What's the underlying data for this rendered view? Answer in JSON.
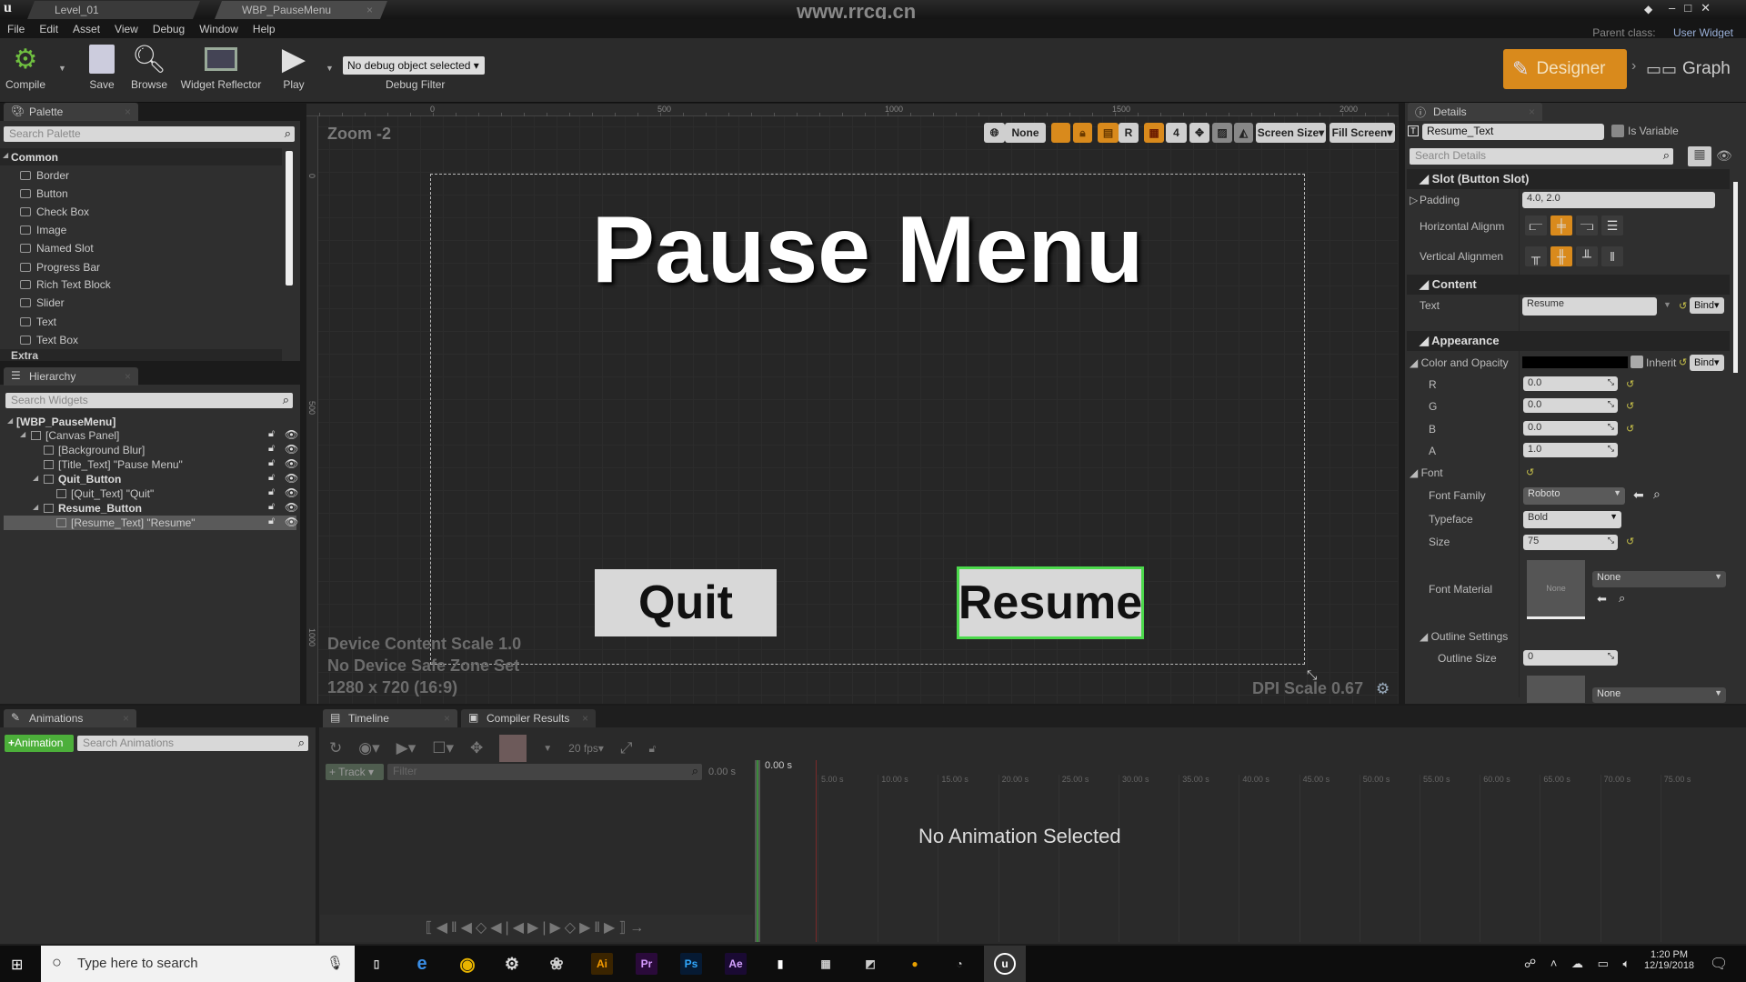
{
  "window": {
    "tabs": [
      "Level_01",
      "WBP_PauseMenu"
    ],
    "watermark": "www.rrcg.cn",
    "parent_class_label": "Parent class:",
    "parent_class": "User Widget"
  },
  "menu": [
    "File",
    "Edit",
    "Asset",
    "View",
    "Debug",
    "Window",
    "Help"
  ],
  "toolbar": {
    "compile": "Compile",
    "save": "Save",
    "browse": "Browse",
    "widget_reflector": "Widget Reflector",
    "play": "Play",
    "debug_object": "No debug object selected",
    "debug_filter": "Debug Filter",
    "designer": "Designer",
    "graph": "Graph"
  },
  "palette": {
    "title": "Palette",
    "search_placeholder": "Search Palette",
    "category": "Common",
    "items": [
      "Border",
      "Button",
      "Check Box",
      "Image",
      "Named Slot",
      "Progress Bar",
      "Rich Text Block",
      "Slider",
      "Text",
      "Text Box"
    ],
    "collapsed_category": "Extra"
  },
  "hierarchy": {
    "title": "Hierarchy",
    "search_placeholder": "Search Widgets",
    "items": [
      {
        "label": "[WBP_PauseMenu]",
        "depth": 0,
        "bold": true,
        "expander": true
      },
      {
        "label": "[Canvas Panel]",
        "depth": 1,
        "expander": true
      },
      {
        "label": "[Background Blur]",
        "depth": 2
      },
      {
        "label": "[Title_Text] \"Pause Menu\"",
        "depth": 2
      },
      {
        "label": "Quit_Button",
        "depth": 2,
        "bold": true,
        "expander": true
      },
      {
        "label": "[Quit_Text] \"Quit\"",
        "depth": 3
      },
      {
        "label": "Resume_Button",
        "depth": 2,
        "bold": true,
        "expander": true
      },
      {
        "label": "[Resume_Text] \"Resume\"",
        "depth": 3,
        "selected": true
      }
    ]
  },
  "canvas": {
    "zoom": "Zoom -2",
    "ruler_labels": [
      "0",
      "500",
      "1000",
      "1500",
      "2000"
    ],
    "left_ruler": [
      "0",
      "500",
      "1000"
    ],
    "toolbar": {
      "none": "None",
      "r": "R",
      "grid_size": "4",
      "screen_size": "Screen Size",
      "fill_screen": "Fill Screen"
    },
    "title_text": "Pause Menu",
    "quit_text": "Quit",
    "resume_text": "Resume",
    "info": [
      "Device Content Scale 1.0",
      "No Device Safe Zone Set",
      "1280 x 720 (16:9)"
    ],
    "dpi_scale": "DPI Scale 0.67"
  },
  "details": {
    "title": "Details",
    "widget_name": "Resume_Text",
    "is_variable": "Is Variable",
    "search_placeholder": "Search Details",
    "slot_header": "Slot (Button Slot)",
    "padding_label": "Padding",
    "padding": "4.0, 2.0",
    "halign_label": "Horizontal Alignm",
    "valign_label": "Vertical Alignmen",
    "content_header": "Content",
    "text_label": "Text",
    "text_value": "Resume",
    "bind": "Bind",
    "appearance_header": "Appearance",
    "color_label": "Color and Opacity",
    "color_value": "#000000",
    "inherit": "Inherit",
    "r_label": "R",
    "r": "0.0",
    "g_label": "G",
    "g": "0.0",
    "b_label": "B",
    "b": "0.0",
    "a_label": "A",
    "a": "1.0",
    "font_label": "Font",
    "font_family_label": "Font Family",
    "font_family": "Roboto",
    "typeface_label": "Typeface",
    "typeface": "Bold",
    "size_label": "Size",
    "size": "75",
    "font_material_label": "Font Material",
    "font_material": "None",
    "thumb_none": "None",
    "outline_header": "Outline Settings",
    "outline_size_label": "Outline Size",
    "outline_size": "0",
    "outline_material": "None"
  },
  "animations": {
    "title": "Animations",
    "add": "Animation",
    "search_placeholder": "Search Animations"
  },
  "timeline": {
    "tab": "Timeline",
    "compiler_tab": "Compiler Results",
    "fps": "20 fps",
    "track": "Track",
    "filter_placeholder": "Filter",
    "time": "0.00 s",
    "current": "0.00 s",
    "empty": "No Animation Selected",
    "ticks": [
      "5.00 s",
      "10.00 s",
      "15.00 s",
      "20.00 s",
      "25.00 s",
      "30.00 s",
      "35.00 s",
      "40.00 s",
      "45.00 s",
      "50.00 s",
      "55.00 s",
      "60.00 s",
      "65.00 s",
      "70.00 s",
      "75.00 s"
    ]
  },
  "taskbar": {
    "search_placeholder": "Type here to search",
    "apps": [
      "Ai",
      "Pr",
      "Ps",
      "Ae"
    ],
    "time": "1:20 PM",
    "date": "12/19/2018"
  },
  "colors": {
    "accent": "#d98a1c",
    "green": "#4caf3a",
    "selected_outline": "#4cd94c"
  }
}
